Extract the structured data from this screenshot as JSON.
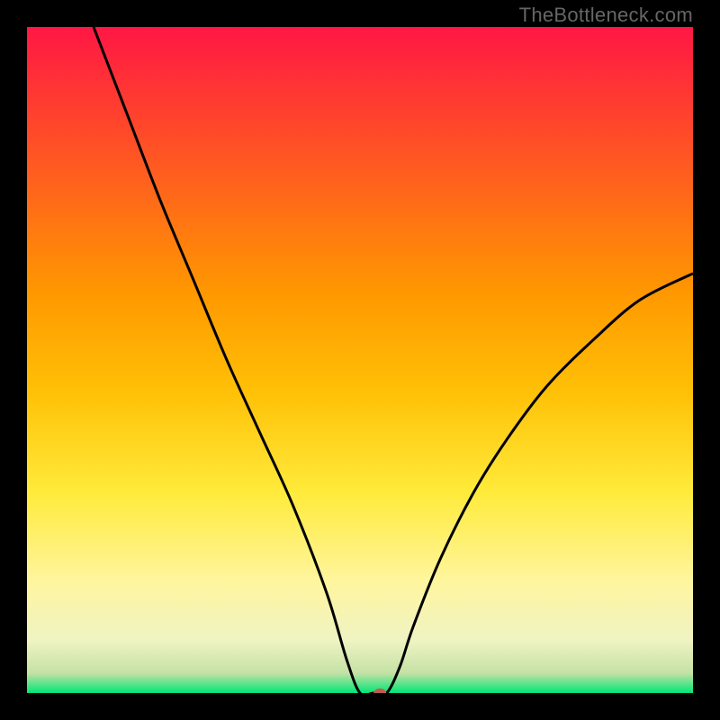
{
  "watermark": "TheBottleneck.com",
  "chart_data": {
    "type": "line",
    "title": "",
    "xlabel": "",
    "ylabel": "",
    "xlim": [
      0,
      100
    ],
    "ylim": [
      0,
      100
    ],
    "grid": false,
    "legend": false,
    "gradient_stops": [
      {
        "offset": 0,
        "color": "#ff1744"
      },
      {
        "offset": 20,
        "color": "#ff5722"
      },
      {
        "offset": 40,
        "color": "#ff9800"
      },
      {
        "offset": 55,
        "color": "#ffc107"
      },
      {
        "offset": 70,
        "color": "#ffeb3b"
      },
      {
        "offset": 83,
        "color": "#fff59d"
      },
      {
        "offset": 92,
        "color": "#f0f4c3"
      },
      {
        "offset": 97,
        "color": "#c5e1a5"
      },
      {
        "offset": 100,
        "color": "#00e676"
      }
    ],
    "series": [
      {
        "name": "bottleneck-curve",
        "color": "#000000",
        "x": [
          10,
          15,
          20,
          25,
          30,
          35,
          40,
          45,
          48,
          50,
          52,
          54,
          56,
          58,
          62,
          67,
          72,
          78,
          85,
          92,
          100
        ],
        "y": [
          100,
          87,
          74,
          62,
          50,
          39,
          28,
          15,
          5,
          0,
          0,
          0,
          4,
          10,
          20,
          30,
          38,
          46,
          53,
          59,
          63
        ]
      }
    ],
    "marker": {
      "x": 53,
      "y": 0,
      "color": "#c25b4e",
      "rx": 7,
      "ry": 5
    }
  }
}
